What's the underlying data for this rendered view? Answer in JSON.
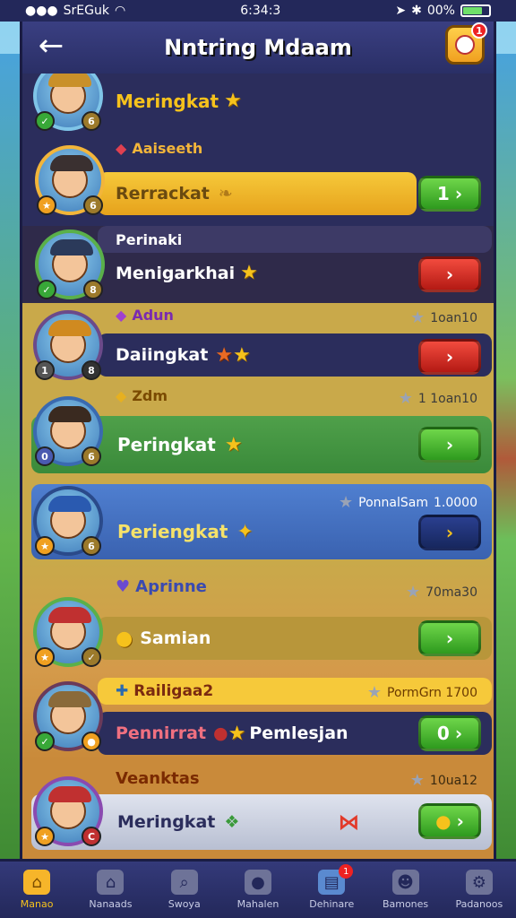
{
  "status": {
    "carrier": "SrEGuk",
    "time": "6:34:3",
    "battery": "00%"
  },
  "header": {
    "title": "Nntring Mdaam",
    "notif_count": "1"
  },
  "rows": [
    {
      "label": "Meringkat",
      "sub": "",
      "button": ""
    },
    {
      "label": "Rerrackat",
      "sub": "Aaiseeth",
      "button": "1"
    },
    {
      "label": "Menigarkhai",
      "sub": "Perinaki",
      "button": ""
    },
    {
      "label": "Daiingkat",
      "sub": "Adun",
      "meta": "1oan10",
      "button": ""
    },
    {
      "label": "Peringkat",
      "sub": "Zdm",
      "meta": "1 1oan10",
      "button": ""
    },
    {
      "label": "Periengkat",
      "sub": "",
      "meta_label": "PonnalSam",
      "meta": "1.0000",
      "button": ""
    },
    {
      "label": "Samian",
      "sub": "Aprinne",
      "meta": "70ma30",
      "button": ""
    },
    {
      "label": "Pennirrat",
      "label2": "Pemlesjan",
      "sub": "Railigaa2",
      "meta": "PormGrn 1700",
      "button": "0"
    },
    {
      "label": "Meringkat",
      "sub": "Veanktas",
      "meta": "10ua12",
      "button": ""
    }
  ],
  "nav": [
    {
      "label": "Manao",
      "icon": "home-icon",
      "active": true
    },
    {
      "label": "Nanaads",
      "icon": "house-icon"
    },
    {
      "label": "Swoya",
      "icon": "search-icon"
    },
    {
      "label": "Mahalen",
      "icon": "chat-icon"
    },
    {
      "label": "Dehinare",
      "icon": "box-icon",
      "badge": "1"
    },
    {
      "label": "Bamones",
      "icon": "people-icon"
    },
    {
      "label": "Padanoos",
      "icon": "gear-icon"
    }
  ],
  "colors": {
    "accent": "#f6c21c",
    "green": "#2e9a1e",
    "red": "#b41a14",
    "navy": "#23285a"
  }
}
